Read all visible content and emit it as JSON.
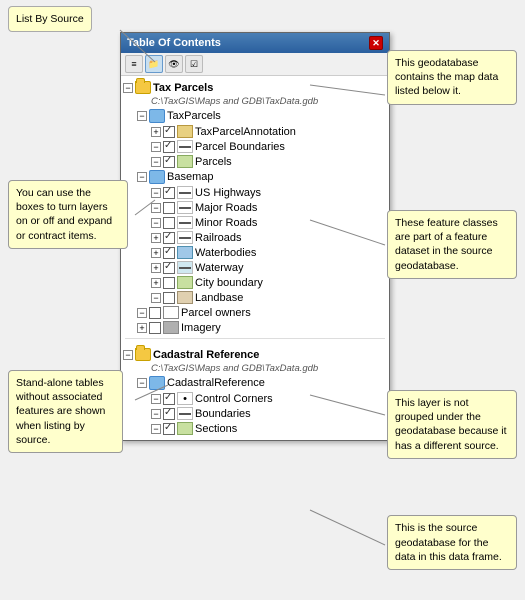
{
  "callouts": {
    "list_by_source": "List By Source",
    "geodatabase": "This geodatabase contains the map data listed below it.",
    "checkboxes": "You can use the boxes to turn layers on or off and expand or contract items.",
    "feature_classes": "These feature classes are part of a feature dataset in the source geodatabase.",
    "standalone": "Stand-alone tables without associated features are shown when listing by source.",
    "different_source": "This layer is not grouped under the geodatabase because it has a different source.",
    "source_gdb": "This is the source geodatabase for the data in this data frame."
  },
  "toc": {
    "title": "Table Of Contents",
    "groups": [
      {
        "name": "Tax Parcels",
        "path": "C:\\TaxGIS\\Maps and GDB\\TaxData.gdb",
        "children": [
          {
            "name": "TaxParcels",
            "type": "folder",
            "children": [
              {
                "name": "TaxParcelAnnotation",
                "type": "layer",
                "checked": true
              },
              {
                "name": "Parcel Boundaries",
                "type": "layer",
                "checked": true
              },
              {
                "name": "Parcels",
                "type": "layer",
                "checked": true
              }
            ]
          },
          {
            "name": "Basemap",
            "type": "folder",
            "children": [
              {
                "name": "US Highways",
                "type": "layer",
                "checked": true
              },
              {
                "name": "Major Roads",
                "type": "layer",
                "checked": false
              },
              {
                "name": "Minor Roads",
                "type": "layer",
                "checked": false
              },
              {
                "name": "Railroads",
                "type": "layer",
                "checked": true
              },
              {
                "name": "Waterbodies",
                "type": "layer",
                "checked": true
              },
              {
                "name": "Waterway",
                "type": "layer",
                "checked": true
              },
              {
                "name": "City boundary",
                "type": "layer",
                "checked": false
              },
              {
                "name": "Landbase",
                "type": "layer",
                "checked": false
              }
            ]
          },
          {
            "name": "Parcel owners",
            "type": "table",
            "checked": false
          },
          {
            "name": "Imagery",
            "type": "layer",
            "checked": false
          }
        ]
      },
      {
        "name": "Cadastral Reference",
        "path": "C:\\TaxGIS\\Maps and GDB\\TaxData.gdb",
        "children": [
          {
            "name": "CadastralReference",
            "type": "folder",
            "children": [
              {
                "name": "Control Corners",
                "type": "layer",
                "checked": true
              },
              {
                "name": "Boundaries",
                "type": "layer",
                "checked": true
              },
              {
                "name": "Sections",
                "type": "layer",
                "checked": true
              }
            ]
          }
        ]
      }
    ]
  }
}
